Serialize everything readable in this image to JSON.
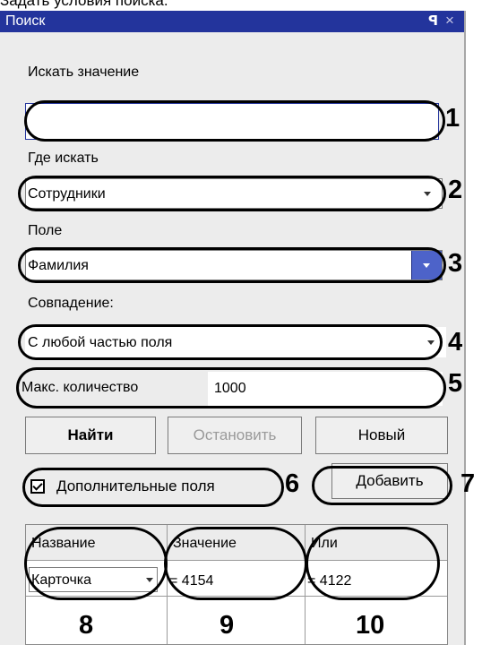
{
  "caption": "Задать условия поиска.",
  "window": {
    "title": "Поиск",
    "pin_glyph": "ꟼ",
    "close_glyph": "×"
  },
  "form": {
    "search_value_label": "Искать значение",
    "search_value": "",
    "where_label": "Где искать",
    "where_value": "Сотрудники",
    "field_label": "Поле",
    "field_value": "Фамилия",
    "match_label": "Совпадение:",
    "match_value": "С любой частью поля",
    "max_label": "Макс. количество",
    "max_value": "1000"
  },
  "buttons": {
    "find": "Найти",
    "stop": "Остановить",
    "new": "Новый",
    "add": "Добавить"
  },
  "extra_fields": {
    "label": "Дополнительные поля",
    "checked": true
  },
  "grid": {
    "headers": [
      "Название",
      "Значение",
      "Или"
    ],
    "row": {
      "name": "Карточка",
      "value": "= 4154",
      "or": "= 4122"
    }
  },
  "callouts": [
    "1",
    "2",
    "3",
    "4",
    "5",
    "6",
    "7",
    "8",
    "9",
    "10"
  ]
}
